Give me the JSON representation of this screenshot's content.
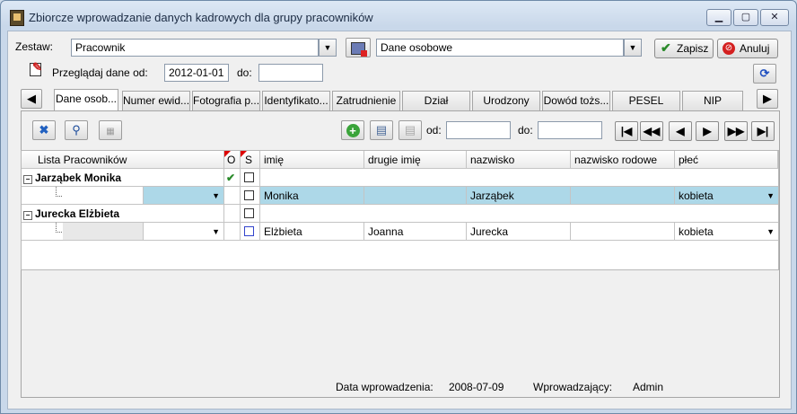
{
  "window": {
    "title": "Zbiorcze wprowadzanie danych kadrowych dla grupy pracowników",
    "minimize": "▁",
    "maximize": "▢",
    "close": "✕"
  },
  "header": {
    "zestaw_label": "Zestaw:",
    "zestaw_value": "Pracownik",
    "section_value": "Dane osobowe",
    "save_label": "Zapisz",
    "cancel_label": "Anuluj",
    "browse_label": "Przeglądaj dane od:",
    "date_from": "2012-01-01",
    "date_to_label": "do:",
    "date_to": ""
  },
  "tabs": [
    "Dane osob...",
    "Numer ewid...",
    "Fotografia p...",
    "Identyfikato...",
    "Zatrudnienie",
    "Dział",
    "Urodzony",
    "Dowód tożs...",
    "PESEL",
    "NIP"
  ],
  "toolbar": {
    "od_label": "od:",
    "do_label": "do:",
    "od_value": "",
    "do_value": "",
    "nav_first": "|◀",
    "nav_prev_page": "◀◀",
    "nav_prev": "◀",
    "nav_next": "▶",
    "nav_next_page": "▶▶",
    "nav_last": "▶|"
  },
  "grid": {
    "columns": {
      "list": "Lista Pracowników",
      "o": "O",
      "s": "S",
      "imie": "imię",
      "drugie": "drugie imię",
      "nazwisko": "nazwisko",
      "rodowe": "nazwisko rodowe",
      "plec": "płeć"
    },
    "groups": [
      {
        "name": "Jarząbek Monika",
        "o_checked": "✔",
        "row": {
          "imie": "Monika",
          "drugie": "",
          "nazwisko": "Jarząbek",
          "rodowe": "",
          "plec": "kobieta"
        }
      },
      {
        "name": "Jurecka Elżbieta",
        "o_checked": "",
        "row": {
          "imie": "Elżbieta",
          "drugie": "Joanna",
          "nazwisko": "Jurecka",
          "rodowe": "",
          "plec": "kobieta"
        }
      }
    ]
  },
  "footer": {
    "entry_date_label": "Data wprowadzenia:",
    "entry_date": "2008-07-09",
    "author_label": "Wprowadzający:",
    "author": "Admin"
  },
  "colors": {
    "selected_row": "#add8e8",
    "accent": "#3a7a2a"
  }
}
